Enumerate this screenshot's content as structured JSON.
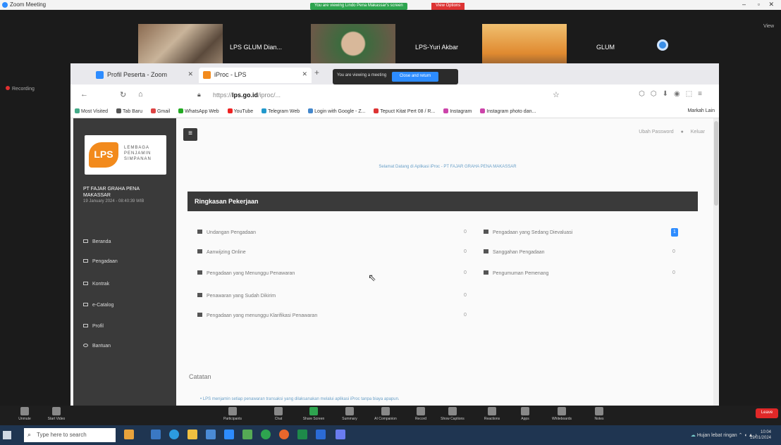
{
  "zoom": {
    "window_title": "Zoom Meeting",
    "share_banner": "You are viewing Lindo Pena Makassar's screen",
    "view_options": "View Options",
    "view_label": "View",
    "recording_label": "Recording",
    "participants": [
      {
        "name": "LPS GLUM Dian...",
        "caption": "LPS GLUM Dian Siswanto"
      },
      {
        "name": "LPS-Yuri Akbar",
        "caption": "LPS-Yuri Akbar"
      },
      {
        "name": "GLUM",
        "caption": "GLUM"
      }
    ],
    "toolbar": [
      "Unmute",
      "Start Video",
      "Participants",
      "Chat",
      "Share Screen",
      "Summary",
      "AI Companion",
      "Record",
      "Show Captions",
      "Reactions",
      "Apps",
      "Whiteboards",
      "Notes"
    ],
    "end_label": "Leave"
  },
  "browser": {
    "tabs": [
      {
        "label": "Profil Peserta - Zoom"
      },
      {
        "label": "iProc - LPS"
      }
    ],
    "share_bar_text": "You are viewing a meeting",
    "share_bar_button": "Close and return",
    "url_prefix": "https://",
    "url_host": "lps.go.id",
    "url_path": "/iproc/...",
    "bookmarks": [
      "Most Visited",
      "Tab Baru",
      "Gmail",
      "WhatsApp Web",
      "YouTube",
      "Telegram Web",
      "Login with Google - Z...",
      "Tepuct Kitat Pert 08 / R...",
      "Instagram",
      "Instagram photo dan..."
    ],
    "bookmarks_right": "Markah Lain",
    "bookmark_colors": [
      "#4a8",
      "#555",
      "#d44",
      "#2a2",
      "#e22",
      "#29c",
      "#48c",
      "#d33",
      "#c4a",
      "#c4a"
    ]
  },
  "app": {
    "logo_mark": "LPS",
    "logo_text": [
      "LEMBAGA",
      "PENJAMIN",
      "SIMPANAN"
    ],
    "company_name": "PT FAJAR GRAHA PENA MAKASSAR",
    "login_time": "19 January 2024 - 08:40:39 WIB",
    "menu": [
      "Beranda",
      "Pengadaan",
      "Kontrak",
      "e-Catalog",
      "Profil",
      "Bantuan"
    ],
    "user_links": [
      "Ubah Password",
      "Keluar"
    ],
    "welcome": "Selamat Datang di Aplikasi iProc - PT FAJAR GRAHA PENA MAKASSAR",
    "section_title": "Ringkasan Pekerjaan",
    "left_rows": [
      {
        "label": "Undangan Pengadaan",
        "count": "0"
      },
      {
        "label": "Aanwijzing Online",
        "count": "0"
      },
      {
        "label": "Pengadaan yang Menunggu Penawaran",
        "count": "0"
      },
      {
        "label": "Penawaran yang Sudah Dikirim",
        "count": "0"
      },
      {
        "label": "Pengadaan yang menunggu Klarifikasi Penawaran",
        "count": "0"
      }
    ],
    "right_rows": [
      {
        "label": "Pengadaan yang Sedang Dievaluasi",
        "count": "1"
      },
      {
        "label": "Sanggahan Pengadaan",
        "count": "0"
      },
      {
        "label": "Pengumuman Pemenang",
        "count": "0"
      }
    ],
    "notes_title": "Catatan",
    "notes_line": "• LPS menjamin setiap penawaran transaksi yang dilaksanakan melalui aplikasi iProc tanpa biaya apapun."
  },
  "taskbar": {
    "search_placeholder": "Type here to search",
    "weather": "Hujan lebat ringan",
    "time": "10:04",
    "date": "19/01/2024"
  }
}
